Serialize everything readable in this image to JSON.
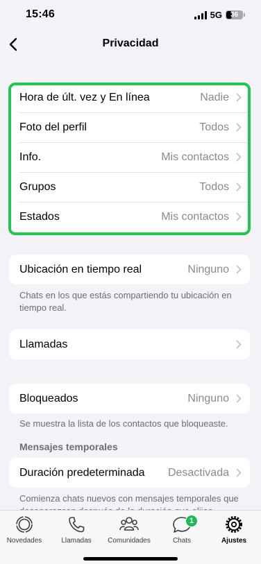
{
  "status_bar": {
    "time": "15:46",
    "network": "5G",
    "battery": "36",
    "battery_level": 0.36
  },
  "nav": {
    "title": "Privacidad"
  },
  "privacy_items": [
    {
      "label": "Hora de últ. vez y En línea",
      "value": "Nadie"
    },
    {
      "label": "Foto del perfil",
      "value": "Todos"
    },
    {
      "label": "Info.",
      "value": "Mis contactos"
    },
    {
      "label": "Grupos",
      "value": "Todos"
    },
    {
      "label": "Estados",
      "value": "Mis contactos"
    }
  ],
  "live_location": {
    "label": "Ubicación en tiempo real",
    "value": "Ninguno",
    "note": "Chats en los que estás compartiendo tu ubicación en tiempo real."
  },
  "calls": {
    "label": "Llamadas"
  },
  "blocked": {
    "label": "Bloqueados",
    "value": "Ninguno",
    "note": "Se muestra la lista de los contactos que bloqueaste."
  },
  "disappearing": {
    "header": "Mensajes temporales",
    "label": "Duración predeterminada",
    "value": "Desactivada",
    "note": "Comienza chats nuevos con mensajes temporales que desaparezcan después de la duración que elijas."
  },
  "tabs": [
    {
      "label": "Novedades",
      "icon": "updates-icon"
    },
    {
      "label": "Llamadas",
      "icon": "phone-icon"
    },
    {
      "label": "Comunidades",
      "icon": "communities-icon"
    },
    {
      "label": "Chats",
      "icon": "chat-bubble-icon",
      "badge": "1"
    },
    {
      "label": "Ajustes",
      "icon": "settings-gear-icon",
      "active": true
    }
  ],
  "colors": {
    "highlight": "#22c553",
    "badge": "#1fb85a",
    "background": "#f2f2f7"
  }
}
